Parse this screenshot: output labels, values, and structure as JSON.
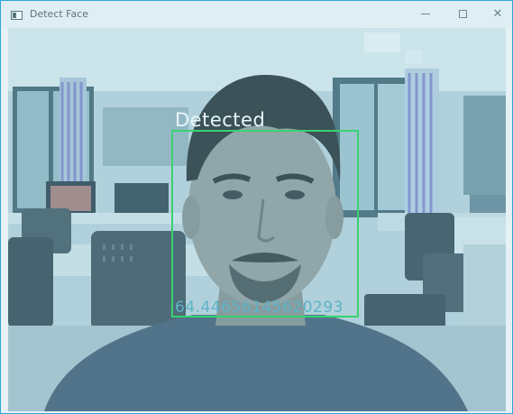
{
  "window": {
    "title": "Detect Face",
    "controls": {
      "minimize_icon": "minimize-icon",
      "maximize_icon": "maximize-icon",
      "close_label": "✕"
    }
  },
  "detection": {
    "label": "Detected",
    "confidence_text": "64.44656145620293",
    "box_color": "#39d26e"
  },
  "colors": {
    "window_border": "#2aa8d8",
    "tint": "#9fd1df"
  }
}
